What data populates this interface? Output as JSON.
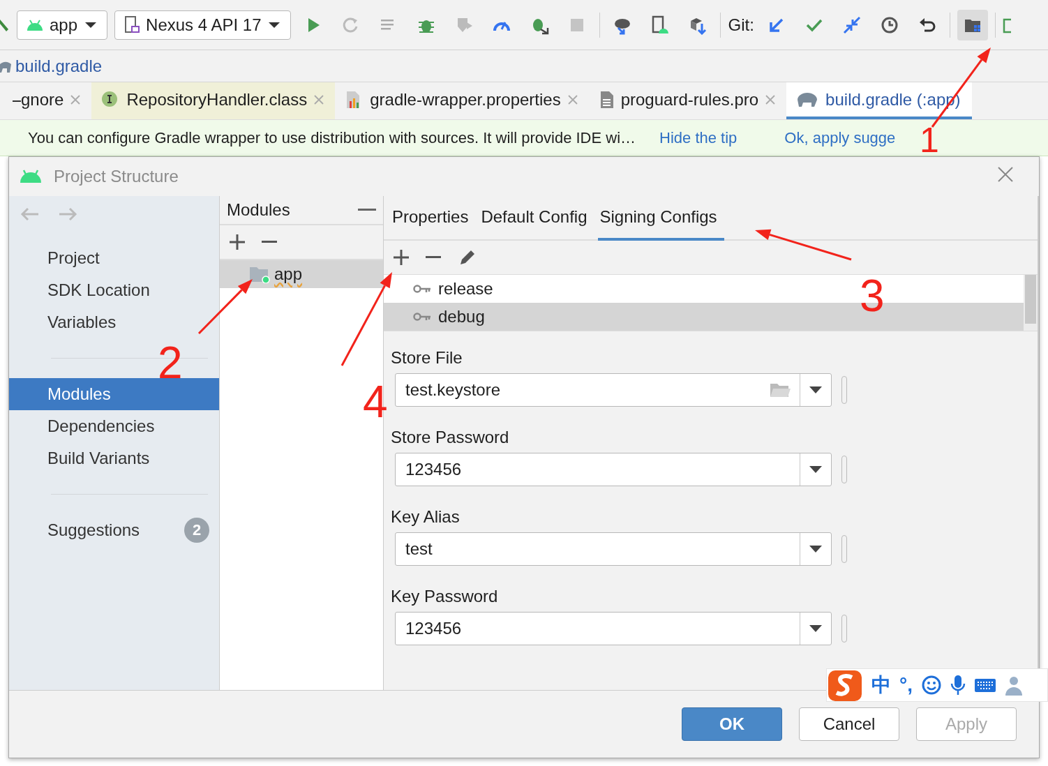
{
  "toolbar": {
    "run_config": "app",
    "device": "Nexus 4 API 17",
    "git_label": "Git:"
  },
  "breadcrumb": "build.gradle",
  "tabs": [
    {
      "label": "gnore",
      "selected": false
    },
    {
      "label": "RepositoryHandler.class",
      "selected": false
    },
    {
      "label": "gradle-wrapper.properties",
      "selected": false
    },
    {
      "label": "proguard-rules.pro",
      "selected": false
    },
    {
      "label": "build.gradle (:app)",
      "selected": true
    }
  ],
  "tip": {
    "message": "You can configure Gradle wrapper to use distribution with sources. It will provide IDE wi…",
    "links": [
      "Hide the tip",
      "Ok, apply sugge"
    ]
  },
  "dialog": {
    "title": "Project Structure",
    "nav_groups": [
      [
        {
          "label": "Project",
          "selected": false
        },
        {
          "label": "SDK Location",
          "selected": false
        },
        {
          "label": "Variables",
          "selected": false
        }
      ],
      [
        {
          "label": "Modules",
          "selected": true
        },
        {
          "label": "Dependencies",
          "selected": false
        },
        {
          "label": "Build Variants",
          "selected": false
        }
      ],
      [
        {
          "label": "Suggestions",
          "selected": false,
          "badge": "2"
        }
      ]
    ],
    "modules": {
      "header": "Modules",
      "items": [
        {
          "label": "app",
          "selected": true
        }
      ]
    },
    "tabs": [
      {
        "label": "Properties",
        "selected": false
      },
      {
        "label": "Default Config",
        "selected": false
      },
      {
        "label": "Signing Configs",
        "selected": true
      }
    ],
    "configs": [
      {
        "name": "release",
        "selected": false
      },
      {
        "name": "debug",
        "selected": true
      }
    ],
    "fields": [
      {
        "label": "Store File",
        "value": "test.keystore",
        "kind": "file"
      },
      {
        "label": "Store Password",
        "value": "123456",
        "kind": "combo"
      },
      {
        "label": "Key Alias",
        "value": "test",
        "kind": "combo"
      },
      {
        "label": "Key Password",
        "value": "123456",
        "kind": "combo"
      }
    ],
    "buttons": [
      {
        "label": "OK",
        "kind": "primary",
        "disabled": false
      },
      {
        "label": "Cancel",
        "kind": "normal",
        "disabled": false
      },
      {
        "label": "Apply",
        "kind": "normal",
        "disabled": true
      }
    ]
  },
  "annotations": [
    {
      "label": "1"
    },
    {
      "label": "2"
    },
    {
      "label": "3"
    },
    {
      "label": "4"
    }
  ],
  "ime_bar": {
    "mode": "中",
    "punctuation": "°,"
  }
}
